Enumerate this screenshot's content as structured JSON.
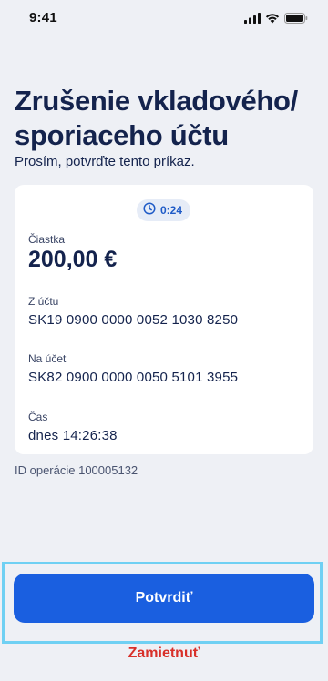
{
  "status_bar": {
    "time": "9:41",
    "icons": [
      "signal-icon",
      "wifi-icon",
      "battery-icon"
    ]
  },
  "header": {
    "title": "Zrušenie vkladového/ sporiaceho účtu",
    "subtitle": "Prosím, potvrďte tento príkaz."
  },
  "card": {
    "timer": "0:24",
    "timer_icon": "clock-icon",
    "fields": [
      {
        "label": "Čiastka",
        "value": "200,00 €"
      },
      {
        "label": "Z účtu",
        "value": "SK19 0900 0000 0052 1030 8250"
      },
      {
        "label": "Na účet",
        "value": "SK82 0900 0000 0050 5101 3955"
      },
      {
        "label": "Čas",
        "value": "dnes 14:26:38"
      }
    ]
  },
  "operation_id": "ID operácie 100005132",
  "actions": {
    "confirm_label": "Potvrdiť",
    "reject_label": "Zamietnuť"
  },
  "colors": {
    "background": "#eef0f5",
    "primary": "#1a5fe0",
    "title": "#14234d",
    "reject": "#d8302a",
    "highlight_frame": "#6fd0f3"
  }
}
